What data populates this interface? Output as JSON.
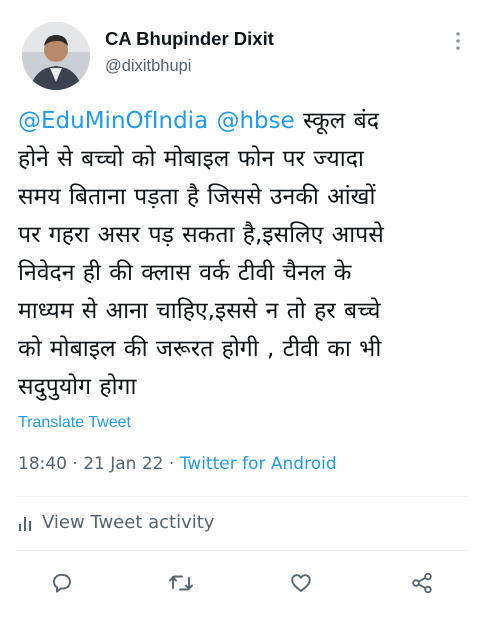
{
  "tweet": {
    "display_name": "CA Bhupinder Dixit",
    "handle": "@dixitbhupi",
    "mentions": [
      "@EduMinOfIndia",
      "@hbse"
    ],
    "text_lines": [
      "स्कूल बंद",
      "होने से बच्चो को मोबाइल फोन पर ज्यादा",
      "समय बिताना पड़ता है जिससे उनकी आंखों",
      "पर गहरा असर पड़ सकता है,इसलिए आपसे",
      "निवेदन ही की क्लास वर्क टीवी चैनल के",
      "माध्यम से आना चाहिए,इससे न तो हर बच्चे",
      "को  मोबाइल की जरूरत होगी , टीवी का भी",
      "सदुपुयोग होगा"
    ],
    "translate_label": "Translate Tweet",
    "time": "18:40",
    "date": "21 Jan 22",
    "separator": "·",
    "source": "Twitter for Android"
  },
  "activity": {
    "label": "View Tweet activity"
  },
  "actions": {
    "reply_icon": "reply-icon",
    "retweet_icon": "retweet-icon",
    "like_icon": "like-icon",
    "share_icon": "share-icon"
  },
  "colors": {
    "accent": "#1d9bf0",
    "secondary_text": "#536471",
    "primary_text": "#0f1419",
    "divider": "#eff3f4"
  }
}
